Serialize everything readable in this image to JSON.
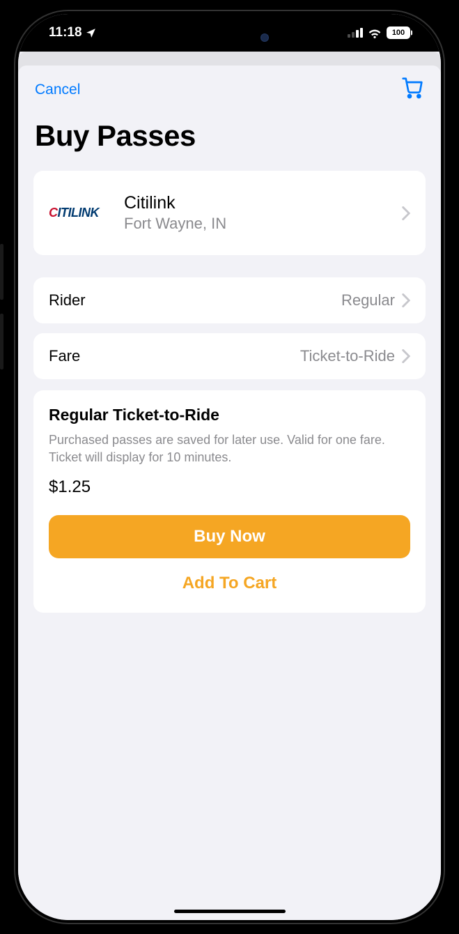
{
  "status": {
    "time": "11:18",
    "battery": "100"
  },
  "nav": {
    "cancel": "Cancel"
  },
  "title": "Buy Passes",
  "agency": {
    "logo_text": "CITILINK",
    "name": "Citilink",
    "location": "Fort Wayne, IN"
  },
  "rider": {
    "label": "Rider",
    "value": "Regular"
  },
  "fare": {
    "label": "Fare",
    "value": "Ticket-to-Ride"
  },
  "detail": {
    "title": "Regular Ticket-to-Ride",
    "description": "Purchased passes are saved for later use. Valid for one fare. Ticket will display for 10 minutes.",
    "price": "$1.25",
    "buy": "Buy Now",
    "add": "Add To Cart"
  }
}
